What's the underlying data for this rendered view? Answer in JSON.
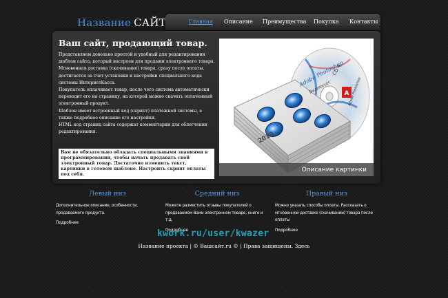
{
  "logo": {
    "part1": "Название",
    "part2": "САЙТА"
  },
  "nav": [
    {
      "label": "Главная",
      "active": true
    },
    {
      "label": "Описание"
    },
    {
      "label": "Преимущества"
    },
    {
      "label": "Покупка"
    },
    {
      "label": "Контакты"
    }
  ],
  "main": {
    "headline": "Ваш сайт, продающий товар.",
    "paragraphs": [
      "Представляем довольно простой и удобный для редактирования шаблон сайта, который настроен для продажи электронного товара.",
      "Мгновенная доставка (скачивание) товара, сразу после оплаты, достигается за счет установки и настройки специального кода системы ИнтернетКасса.",
      "Покупатель оплачивает товар, после чего система автоматически переводит его на страницу, на которой можно скачать оплаченный электронный продукт.",
      "Шаблон имеет встроенный код (скрипт) платежной системы, а также подробное описание его настройки.",
      "HTML код страниц сайта содержат комментарии для облегчения редактирования."
    ],
    "note": "Вам не обязательно обладать специальными знаниями в программировании, чтобы начать продавать свой электронный товар. Достаточно изменить текст, картинки в готовом шаблоне. Настроить скрипт оплаты под себя."
  },
  "hero": {
    "caption": "Описание картинки",
    "disc_text": "CD 4",
    "box_title": "Adobe Photoshop",
    "box_sub": "Видеокурс",
    "box_year": "2010",
    "brand": "Adobe Photoshop"
  },
  "columns": [
    {
      "title": "Левый низ",
      "text": "Дополнительное описание, особенности, продаваемого продукта.",
      "more": "Подробнее"
    },
    {
      "title": "Средний низ",
      "text": "Можете разместить отзывы покупателей о продаваемом Вами электронном товаре, книге и т.д.",
      "more": "Подробнее"
    },
    {
      "title": "Правый низ",
      "text": "Можно указать способы оплаты. Рассказать о мгновенной доставке (скачивании) товара после оплаты",
      "more": "Подробнее"
    }
  ],
  "watermark": "kwork.ru/user/kwazer",
  "footer": "Название проекта | © Вашсайт.ru © | Права защищены. Здесь",
  "colors": {
    "accent": "#5a98e0",
    "watermark": "#1aa5b8",
    "background": "#1c1c1c"
  }
}
